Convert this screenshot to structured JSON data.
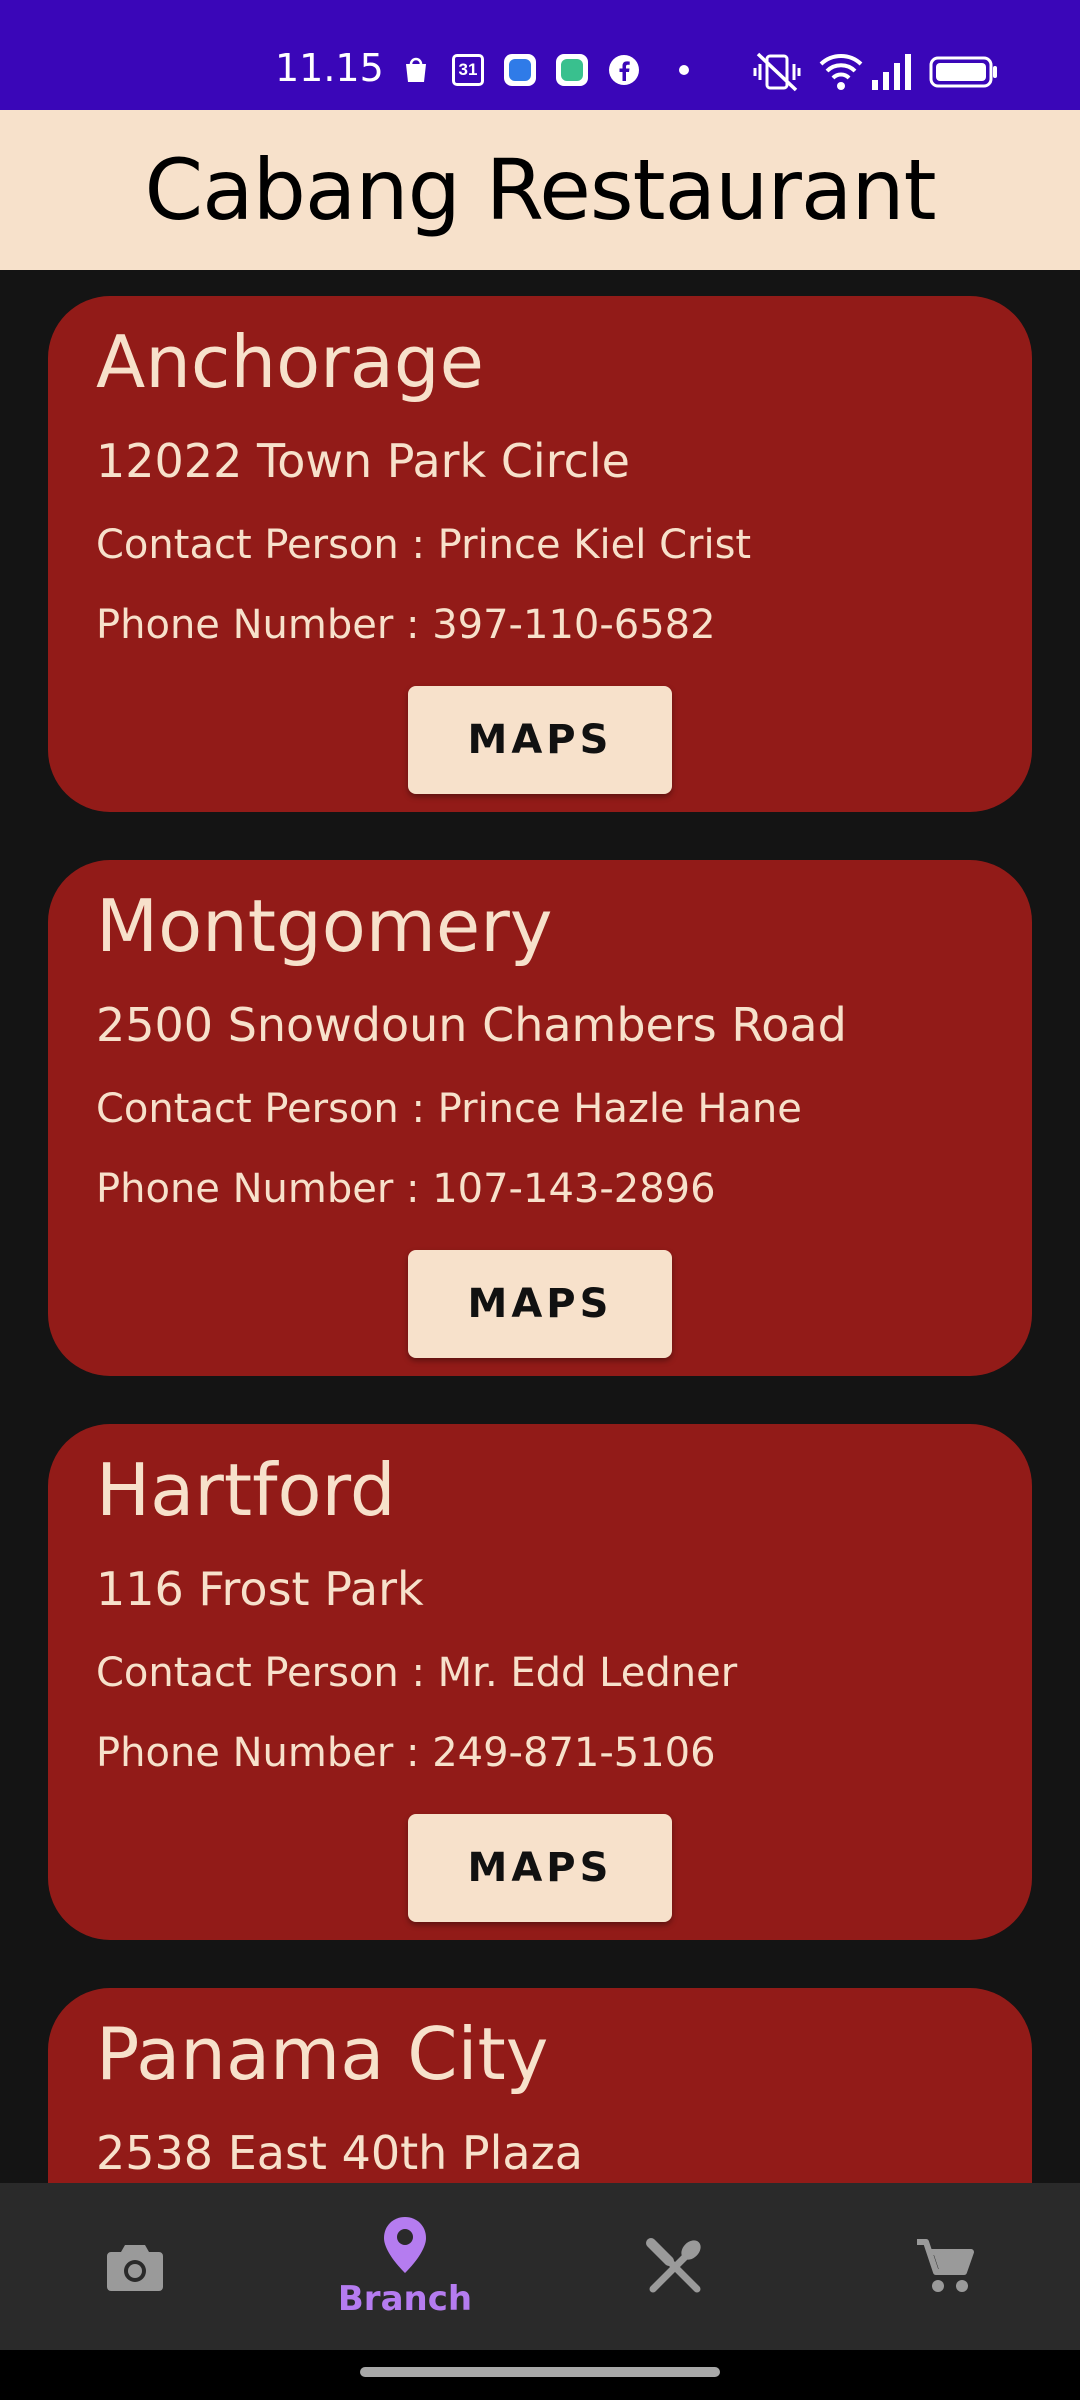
{
  "status_bar": {
    "time": "11.15",
    "icons": [
      "shopping-bag-icon",
      "calendar-icon",
      "app-icon",
      "app-icon",
      "facebook-icon",
      "dot-icon",
      "vibrate-off-icon",
      "wifi-icon",
      "signal-icon",
      "battery-icon"
    ],
    "calendar_day": "31"
  },
  "app_bar": {
    "title": "Cabang Restaurant"
  },
  "branches": [
    {
      "city": "Anchorage",
      "address": "12022 Town Park Circle",
      "contact": "Contact Person : Prince Kiel Crist",
      "phone": "Phone Number : 397-110-6582",
      "button": "MAPS"
    },
    {
      "city": "Montgomery",
      "address": "2500 Snowdoun Chambers Road",
      "contact": "Contact Person : Prince Hazle Hane",
      "phone": "Phone Number : 107-143-2896",
      "button": "MAPS"
    },
    {
      "city": "Hartford",
      "address": "116 Frost Park",
      "contact": "Contact Person : Mr. Edd Ledner",
      "phone": "Phone Number : 249-871-5106",
      "button": "MAPS"
    },
    {
      "city": "Panama City",
      "address": "2538 East 40th Plaza",
      "contact": "",
      "phone": "",
      "button": ""
    }
  ],
  "bottom_nav": {
    "items": [
      {
        "icon": "camera-icon",
        "label": ""
      },
      {
        "icon": "location-pin-icon",
        "label": "Branch",
        "selected": true
      },
      {
        "icon": "restaurant-icon",
        "label": ""
      },
      {
        "icon": "cart-icon",
        "label": ""
      }
    ]
  },
  "colors": {
    "status_bar": "#3a06b8",
    "app_bar": "#f7e1cb",
    "card": "#921b18",
    "card_text": "#f7e1cb",
    "background": "#141414",
    "nav_bg": "#2a2a2a",
    "nav_selected": "#b57cf0",
    "nav_icon": "#9a9a9a"
  }
}
